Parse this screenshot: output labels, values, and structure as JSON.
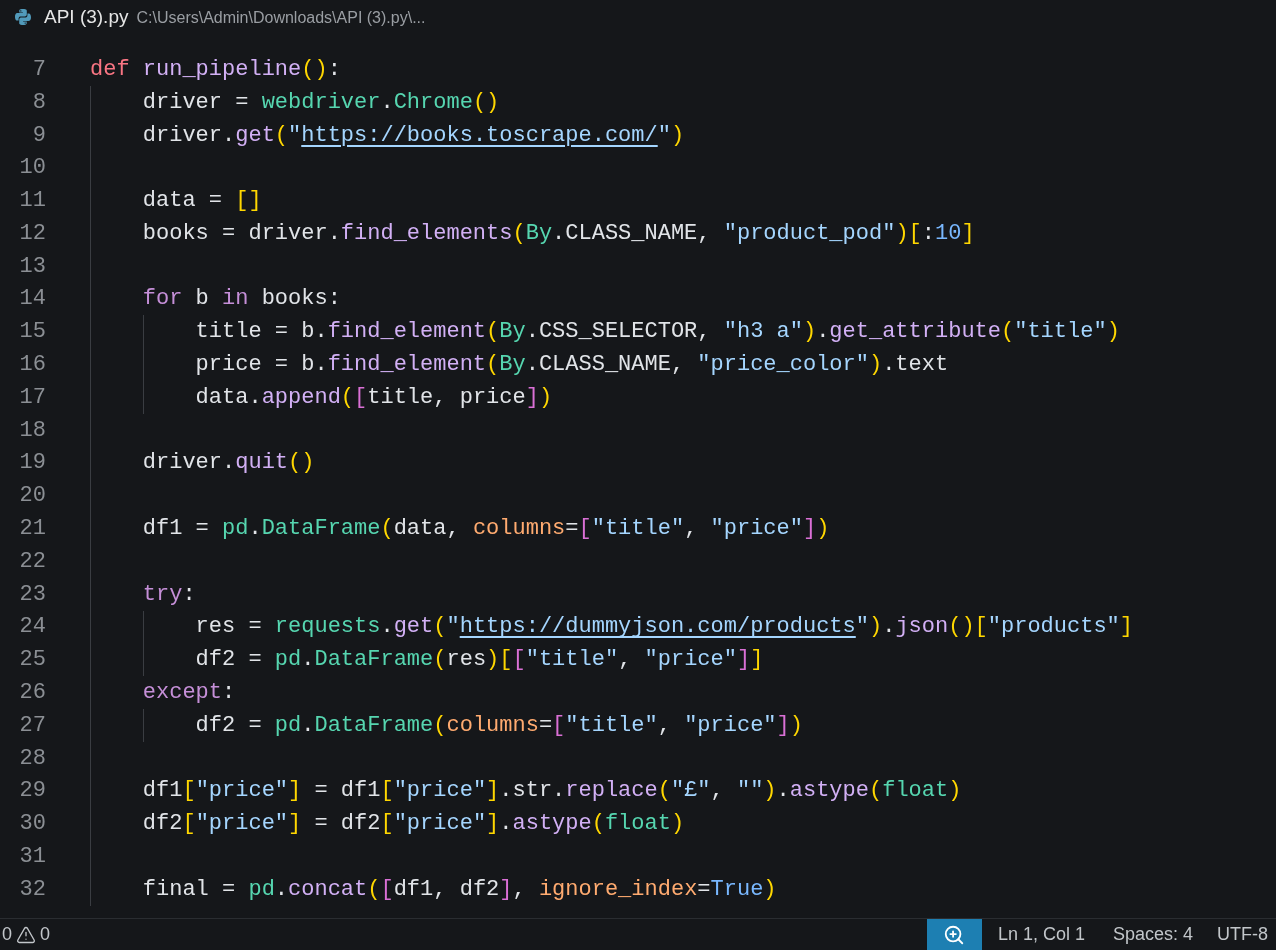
{
  "header": {
    "file_name": "API (3).py",
    "path": "C:\\Users\\Admin\\Downloads\\API (3).py\\..."
  },
  "lines": [
    {
      "number": "7",
      "tokens": [
        {
          "t": "def",
          "kind": "def"
        },
        {
          "t": " run_pipeline",
          "kind": "func"
        },
        {
          "t": "()",
          "kind": "b1"
        },
        {
          "t": ":",
          "kind": "plain"
        }
      ]
    },
    {
      "number": "8",
      "tokens": [
        {
          "t": "    driver = ",
          "kind": "plain"
        },
        {
          "t": "webdriver",
          "kind": "cls"
        },
        {
          "t": ".",
          "kind": "plain"
        },
        {
          "t": "Chrome",
          "kind": "cls"
        },
        {
          "t": "()",
          "kind": "b1"
        }
      ]
    },
    {
      "number": "9",
      "tokens": [
        {
          "t": "    driver.",
          "kind": "plain"
        },
        {
          "t": "get",
          "kind": "func"
        },
        {
          "t": "(",
          "kind": "b1"
        },
        {
          "t": "\"",
          "kind": "str"
        },
        {
          "t": "https://books.toscrape.com/",
          "kind": "link"
        },
        {
          "t": "\"",
          "kind": "str"
        },
        {
          "t": ")",
          "kind": "b1"
        }
      ]
    },
    {
      "number": "10"
    },
    {
      "number": "11",
      "tokens": [
        {
          "t": "    data = ",
          "kind": "plain"
        },
        {
          "t": "[]",
          "kind": "b1"
        }
      ]
    },
    {
      "number": "12",
      "tokens": [
        {
          "t": "    books = driver.",
          "kind": "plain"
        },
        {
          "t": "find_elements",
          "kind": "func"
        },
        {
          "t": "(",
          "kind": "b1"
        },
        {
          "t": "By",
          "kind": "cls"
        },
        {
          "t": ".CLASS_NAME, ",
          "kind": "plain"
        },
        {
          "t": "\"product_pod\"",
          "kind": "str"
        },
        {
          "t": ")[",
          "kind": "b1"
        },
        {
          "t": ":",
          "kind": "plain"
        },
        {
          "t": "10",
          "kind": "num"
        },
        {
          "t": "]",
          "kind": "b1"
        }
      ]
    },
    {
      "number": "13"
    },
    {
      "number": "14",
      "tokens": [
        {
          "t": "    for",
          "kind": "keyword"
        },
        {
          "t": " b ",
          "kind": "plain"
        },
        {
          "t": "in",
          "kind": "keyword"
        },
        {
          "t": " books:",
          "kind": "plain"
        }
      ]
    },
    {
      "number": "15",
      "tokens": [
        {
          "t": "        title = b.",
          "kind": "plain"
        },
        {
          "t": "find_element",
          "kind": "func"
        },
        {
          "t": "(",
          "kind": "b1"
        },
        {
          "t": "By",
          "kind": "cls"
        },
        {
          "t": ".CSS_SELECTOR, ",
          "kind": "plain"
        },
        {
          "t": "\"h3 a\"",
          "kind": "str"
        },
        {
          "t": ")",
          "kind": "b1"
        },
        {
          "t": ".",
          "kind": "plain"
        },
        {
          "t": "get_attribute",
          "kind": "func"
        },
        {
          "t": "(",
          "kind": "b1"
        },
        {
          "t": "\"title\"",
          "kind": "str"
        },
        {
          "t": ")",
          "kind": "b1"
        }
      ]
    },
    {
      "number": "16",
      "tokens": [
        {
          "t": "        price = b.",
          "kind": "plain"
        },
        {
          "t": "find_element",
          "kind": "func"
        },
        {
          "t": "(",
          "kind": "b1"
        },
        {
          "t": "By",
          "kind": "cls"
        },
        {
          "t": ".CLASS_NAME, ",
          "kind": "plain"
        },
        {
          "t": "\"price_color\"",
          "kind": "str"
        },
        {
          "t": ")",
          "kind": "b1"
        },
        {
          "t": ".text",
          "kind": "plain"
        }
      ]
    },
    {
      "number": "17",
      "tokens": [
        {
          "t": "        data.",
          "kind": "plain"
        },
        {
          "t": "append",
          "kind": "func"
        },
        {
          "t": "(",
          "kind": "b1"
        },
        {
          "t": "[",
          "kind": "b2"
        },
        {
          "t": "title, price",
          "kind": "plain"
        },
        {
          "t": "]",
          "kind": "b2"
        },
        {
          "t": ")",
          "kind": "b1"
        }
      ]
    },
    {
      "number": "18"
    },
    {
      "number": "19",
      "tokens": [
        {
          "t": "    driver.",
          "kind": "plain"
        },
        {
          "t": "quit",
          "kind": "func"
        },
        {
          "t": "()",
          "kind": "b1"
        }
      ]
    },
    {
      "number": "20"
    },
    {
      "number": "21",
      "tokens": [
        {
          "t": "    df1 = ",
          "kind": "plain"
        },
        {
          "t": "pd",
          "kind": "cls"
        },
        {
          "t": ".",
          "kind": "plain"
        },
        {
          "t": "DataFrame",
          "kind": "cls"
        },
        {
          "t": "(",
          "kind": "b1"
        },
        {
          "t": "data, ",
          "kind": "plain"
        },
        {
          "t": "columns",
          "kind": "param"
        },
        {
          "t": "=",
          "kind": "plain"
        },
        {
          "t": "[",
          "kind": "b2"
        },
        {
          "t": "\"title\"",
          "kind": "str"
        },
        {
          "t": ", ",
          "kind": "plain"
        },
        {
          "t": "\"price\"",
          "kind": "str"
        },
        {
          "t": "]",
          "kind": "b2"
        },
        {
          "t": ")",
          "kind": "b1"
        }
      ]
    },
    {
      "number": "22"
    },
    {
      "number": "23",
      "tokens": [
        {
          "t": "    try",
          "kind": "keyword"
        },
        {
          "t": ":",
          "kind": "plain"
        }
      ]
    },
    {
      "number": "24",
      "tokens": [
        {
          "t": "        res = ",
          "kind": "plain"
        },
        {
          "t": "requests",
          "kind": "cls"
        },
        {
          "t": ".",
          "kind": "plain"
        },
        {
          "t": "get",
          "kind": "func"
        },
        {
          "t": "(",
          "kind": "b1"
        },
        {
          "t": "\"",
          "kind": "str"
        },
        {
          "t": "https://dummyjson.com/products",
          "kind": "link"
        },
        {
          "t": "\"",
          "kind": "str"
        },
        {
          "t": ")",
          "kind": "b1"
        },
        {
          "t": ".",
          "kind": "plain"
        },
        {
          "t": "json",
          "kind": "func"
        },
        {
          "t": "()[",
          "kind": "b1"
        },
        {
          "t": "\"products\"",
          "kind": "str"
        },
        {
          "t": "]",
          "kind": "b1"
        }
      ]
    },
    {
      "number": "25",
      "tokens": [
        {
          "t": "        df2 = ",
          "kind": "plain"
        },
        {
          "t": "pd",
          "kind": "cls"
        },
        {
          "t": ".",
          "kind": "plain"
        },
        {
          "t": "DataFrame",
          "kind": "cls"
        },
        {
          "t": "(",
          "kind": "b1"
        },
        {
          "t": "res",
          "kind": "plain"
        },
        {
          "t": ")[",
          "kind": "b1"
        },
        {
          "t": "[",
          "kind": "b2"
        },
        {
          "t": "\"title\"",
          "kind": "str"
        },
        {
          "t": ", ",
          "kind": "plain"
        },
        {
          "t": "\"price\"",
          "kind": "str"
        },
        {
          "t": "]",
          "kind": "b2"
        },
        {
          "t": "]",
          "kind": "b1"
        }
      ]
    },
    {
      "number": "26",
      "tokens": [
        {
          "t": "    except",
          "kind": "keyword"
        },
        {
          "t": ":",
          "kind": "plain"
        }
      ]
    },
    {
      "number": "27",
      "tokens": [
        {
          "t": "        df2 = ",
          "kind": "plain"
        },
        {
          "t": "pd",
          "kind": "cls"
        },
        {
          "t": ".",
          "kind": "plain"
        },
        {
          "t": "DataFrame",
          "kind": "cls"
        },
        {
          "t": "(",
          "kind": "b1"
        },
        {
          "t": "columns",
          "kind": "param"
        },
        {
          "t": "=",
          "kind": "plain"
        },
        {
          "t": "[",
          "kind": "b2"
        },
        {
          "t": "\"title\"",
          "kind": "str"
        },
        {
          "t": ", ",
          "kind": "plain"
        },
        {
          "t": "\"price\"",
          "kind": "str"
        },
        {
          "t": "]",
          "kind": "b2"
        },
        {
          "t": ")",
          "kind": "b1"
        }
      ]
    },
    {
      "number": "28"
    },
    {
      "number": "29",
      "tokens": [
        {
          "t": "    df1",
          "kind": "plain"
        },
        {
          "t": "[",
          "kind": "b1"
        },
        {
          "t": "\"price\"",
          "kind": "str"
        },
        {
          "t": "]",
          "kind": "b1"
        },
        {
          "t": " = df1",
          "kind": "plain"
        },
        {
          "t": "[",
          "kind": "b1"
        },
        {
          "t": "\"price\"",
          "kind": "str"
        },
        {
          "t": "]",
          "kind": "b1"
        },
        {
          "t": ".str.",
          "kind": "plain"
        },
        {
          "t": "replace",
          "kind": "func"
        },
        {
          "t": "(",
          "kind": "b1"
        },
        {
          "t": "\"£\"",
          "kind": "str"
        },
        {
          "t": ", ",
          "kind": "plain"
        },
        {
          "t": "\"\"",
          "kind": "str"
        },
        {
          "t": ")",
          "kind": "b1"
        },
        {
          "t": ".",
          "kind": "plain"
        },
        {
          "t": "astype",
          "kind": "func"
        },
        {
          "t": "(",
          "kind": "b1"
        },
        {
          "t": "float",
          "kind": "cls"
        },
        {
          "t": ")",
          "kind": "b1"
        }
      ]
    },
    {
      "number": "30",
      "tokens": [
        {
          "t": "    df2",
          "kind": "plain"
        },
        {
          "t": "[",
          "kind": "b1"
        },
        {
          "t": "\"price\"",
          "kind": "str"
        },
        {
          "t": "]",
          "kind": "b1"
        },
        {
          "t": " = df2",
          "kind": "plain"
        },
        {
          "t": "[",
          "kind": "b1"
        },
        {
          "t": "\"price\"",
          "kind": "str"
        },
        {
          "t": "]",
          "kind": "b1"
        },
        {
          "t": ".",
          "kind": "plain"
        },
        {
          "t": "astype",
          "kind": "func"
        },
        {
          "t": "(",
          "kind": "b1"
        },
        {
          "t": "float",
          "kind": "cls"
        },
        {
          "t": ")",
          "kind": "b1"
        }
      ]
    },
    {
      "number": "31"
    },
    {
      "number": "32",
      "tokens": [
        {
          "t": "    final = ",
          "kind": "plain"
        },
        {
          "t": "pd",
          "kind": "cls"
        },
        {
          "t": ".",
          "kind": "plain"
        },
        {
          "t": "concat",
          "kind": "func"
        },
        {
          "t": "(",
          "kind": "b1"
        },
        {
          "t": "[",
          "kind": "b2"
        },
        {
          "t": "df1, df2",
          "kind": "plain"
        },
        {
          "t": "]",
          "kind": "b2"
        },
        {
          "t": ", ",
          "kind": "plain"
        },
        {
          "t": "ignore_index",
          "kind": "param"
        },
        {
          "t": "=",
          "kind": "plain"
        },
        {
          "t": "True",
          "kind": "num"
        },
        {
          "t": ")",
          "kind": "b1"
        }
      ]
    }
  ],
  "status_bar": {
    "errors": "0",
    "warnings": "0",
    "cursor": "Ln 1, Col 1",
    "spaces": "Spaces: 4",
    "encoding": "UTF-8"
  }
}
